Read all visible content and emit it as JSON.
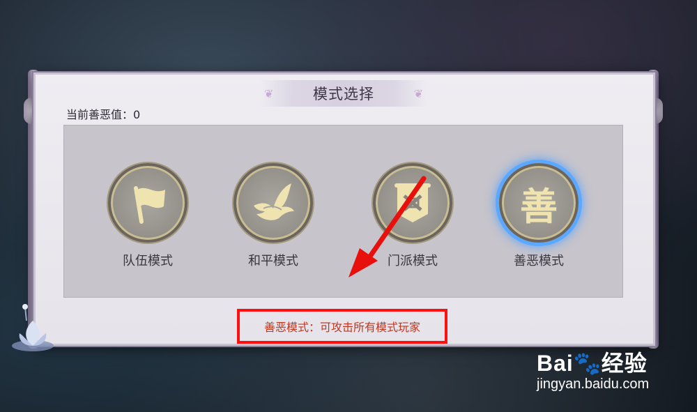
{
  "dialog": {
    "title": "模式选择",
    "karma_label": "当前善恶值：0",
    "modes": [
      {
        "label": "队伍模式",
        "icon": "flag-icon",
        "active": false
      },
      {
        "label": "和平模式",
        "icon": "dove-icon",
        "active": false
      },
      {
        "label": "门派模式",
        "icon": "sect-banner-icon",
        "active": false
      },
      {
        "label": "善恶模式",
        "icon": "karma-icon",
        "active": true,
        "glyph": "善"
      }
    ],
    "description": "善恶模式：可攻击所有模式玩家"
  },
  "watermark": {
    "brand_prefix": "Bai",
    "brand_suffix": "经验",
    "site": "jingyan.baidu.com"
  },
  "colors": {
    "highlight_box": "#ff1010",
    "arrow": "#e8100c",
    "active_ring": "#5aa8ff",
    "description_text": "#c4361b"
  }
}
